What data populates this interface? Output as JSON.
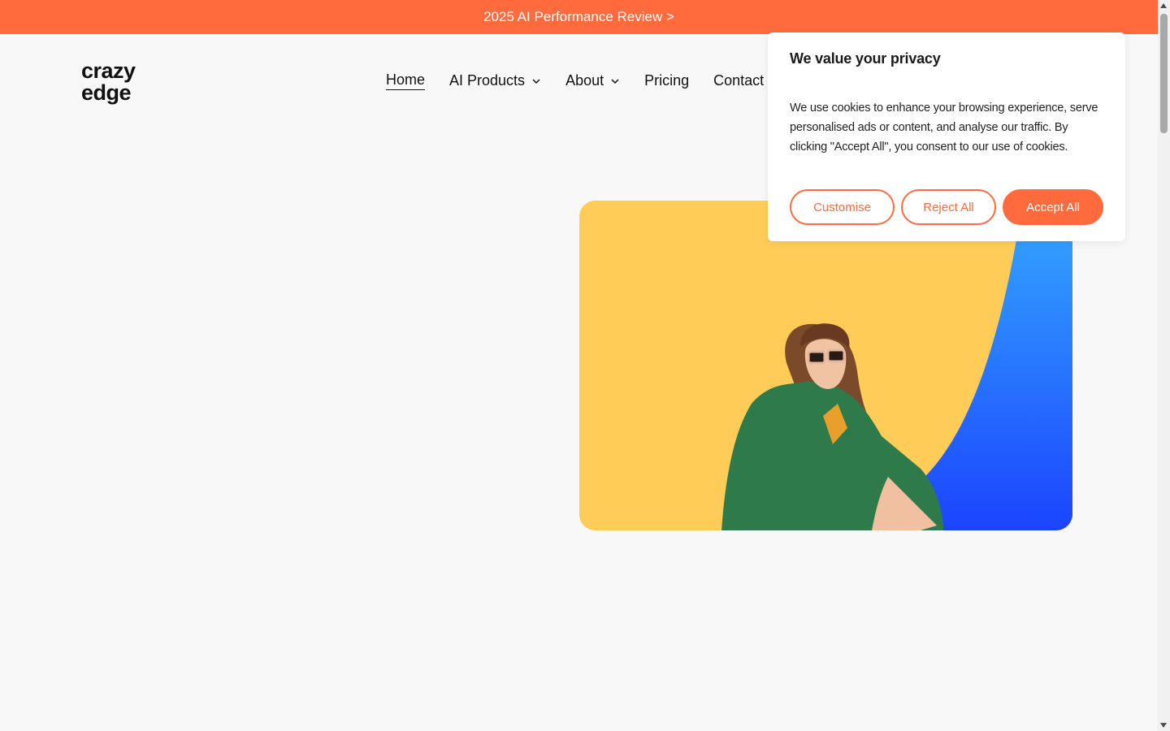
{
  "banner": {
    "text": "2025 AI Performance Review >"
  },
  "logo": {
    "line1": "crazy",
    "line2": "edge"
  },
  "nav": {
    "items": [
      {
        "label": "Home",
        "active": true
      },
      {
        "label": "AI Products",
        "dropdown": true
      },
      {
        "label": "About",
        "dropdown": true
      },
      {
        "label": "Pricing"
      },
      {
        "label": "Contact"
      }
    ]
  },
  "cookie": {
    "title": "We value your privacy",
    "body": "We use cookies to enhance your browsing experience, serve personalised ads or content, and analyse our traffic. By clicking \"Accept All\", you consent to our use of cookies.",
    "customise": "Customise",
    "reject": "Reject All",
    "accept": "Accept All"
  },
  "colors": {
    "accent": "#ff6b3d",
    "hero_yellow": "#ffcd57",
    "hero_blue": "#2f7bff",
    "blazer_green": "#2e7a4a"
  },
  "icons": {
    "dropdown": "chevron-down-icon",
    "scroll_up": "arrow-up-icon",
    "scroll_down": "arrow-down-icon"
  }
}
